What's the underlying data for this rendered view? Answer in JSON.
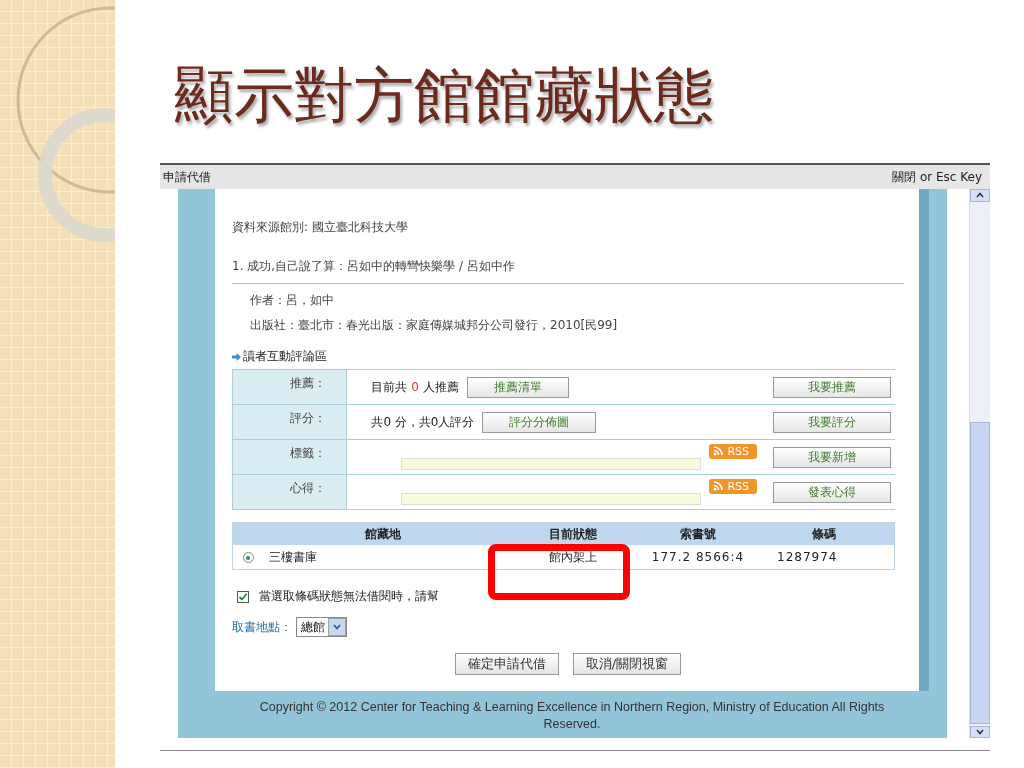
{
  "slide": {
    "title": "顯示對方館館藏狀態"
  },
  "window": {
    "title": "申請代借",
    "close_text": "關閉 or Esc Key"
  },
  "record": {
    "source": "資料來源館別: 國立臺北科技大學",
    "item": "1. 成功,自己說了算：呂如中的轉彎快樂學 / 呂如中作",
    "details": [
      "作者：呂，如中",
      "出版社：臺北市：春光出版：家庭傳媒城邦分公司發行，2010[民99]"
    ]
  },
  "reviews": {
    "heading": "讀者互動評論區",
    "rows": [
      {
        "kind": "count",
        "label": "推薦：",
        "prefix": "目前共",
        "count": "0",
        "suffix": "人推薦",
        "button": "推薦清單",
        "action": "我要推薦"
      },
      {
        "kind": "score",
        "label": "評分：",
        "text": "共0 分，共0人評分",
        "button": "評分分佈圖",
        "action": "我要評分"
      },
      {
        "kind": "input",
        "label": "標籤：",
        "rss": "RSS",
        "action": "我要新增"
      },
      {
        "kind": "input",
        "label": "心得：",
        "rss": "RSS",
        "action": "發表心得"
      }
    ]
  },
  "holdings": {
    "columns": [
      "館藏地",
      "目前狀態",
      "索書號",
      "條碼"
    ],
    "rows": [
      {
        "selected": true,
        "cells": [
          "三樓書庫",
          "館內架上",
          "177.2 8566:4",
          "1287974"
        ]
      }
    ]
  },
  "option": {
    "checked": true,
    "label": "當選取條碼狀態無法借閱時，請幫"
  },
  "pickup": {
    "label": "取書地點：",
    "value": "總館"
  },
  "buttons": [
    "確定申請代借",
    "取消/關閉視窗"
  ],
  "footer": "Copyright © 2012 Center for Teaching & Learning Excellence in Northern Region, Ministry of Education All Rights Reserved."
}
